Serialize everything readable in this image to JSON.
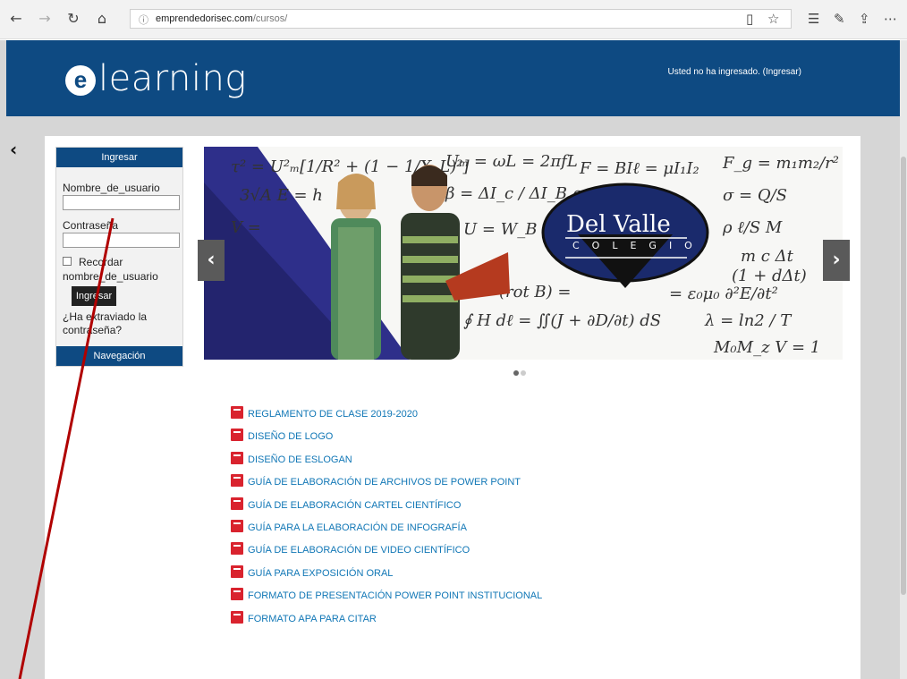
{
  "browser": {
    "url_host": "emprendedorisec.com",
    "url_path": "/cursos/"
  },
  "header": {
    "logo_letter": "e",
    "logo_text": "learning",
    "login_status": "Usted no ha ingresado. (Ingresar)",
    "background": "#0e4a82"
  },
  "login_block": {
    "title": "Ingresar",
    "username_label": "Nombre_de_usuario",
    "password_label": "Contraseña",
    "remember_label": "Recordar nombre_de_usuario",
    "submit_label": "Ingresar",
    "forgot_label": "¿Ha extraviado la contraseña?",
    "navigation_title": "Navegación"
  },
  "carousel": {
    "school_name": "Del Valle",
    "school_sub": "COLEGIO",
    "slide_count": 2,
    "active_slide": 1
  },
  "documents": [
    "REGLAMENTO DE CLASE 2019-2020",
    "DISEÑO DE LOGO",
    "DISEÑO DE ESLOGAN",
    "GUÍA DE ELABORACIÓN DE ARCHIVOS DE POWER POINT",
    "GUÍA DE ELABORACIÓN CARTEL CIENTÍFICO",
    "GUÍA PARA LA ELABORACIÓN DE INFOGRAFÍA",
    "GUÍA DE ELABORACIÓN DE VIDEO CIENTÍFICO",
    "GUÍA PARA EXPOSICIÓN ORAL",
    "FORMATO DE PRESENTACIÓN POWER POINT INSTITUCIONAL",
    "FORMATO APA PARA CITAR"
  ],
  "colors": {
    "link": "#1177b6",
    "pdf_icon": "#d9232e",
    "annotation_line": "#b00000"
  }
}
